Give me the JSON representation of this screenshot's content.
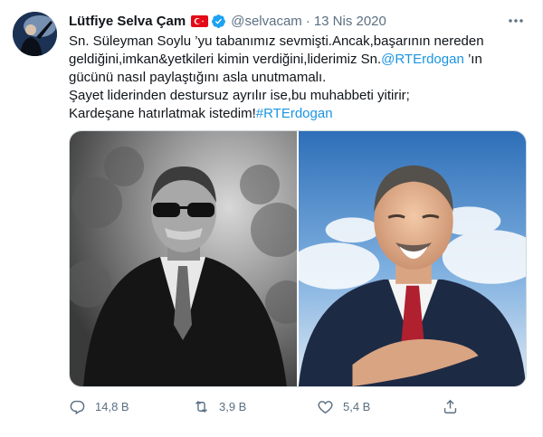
{
  "author": {
    "name": "Lütfiye Selva Çam",
    "handle": "@selvacam",
    "separator": "·",
    "date": "13 Nis 2020"
  },
  "tweet": {
    "line1": "Sn. Süleyman Soylu ’yu tabanımız sevmişti.Ancak,başarının nereden",
    "line2_pre": "geldiğini,imkan&yetkileri kimin verdiğini,liderimiz Sn.",
    "line2_mention": "@RTErdogan",
    "line2_post": " ’ın",
    "line3": "gücünü nasıl paylaştığını asla unutmamalı.",
    "line4": "Şayet liderinden destursuz ayrılır ise,bu muhabbeti yitirir;",
    "line5_pre": "Kardeşane hatırlatmak istedim!",
    "line5_hashtag": "#RTErdogan"
  },
  "actions": {
    "reply_count": "14,8 B",
    "retweet_count": "3,9 B",
    "like_count": "5,4 B"
  },
  "colors": {
    "link": "#1b95e0",
    "verified": "#1da1f2",
    "secondary_text": "#5b7083"
  },
  "icons": [
    "verified-badge-icon",
    "turkish-flag-icon",
    "more-options-icon",
    "reply-icon",
    "retweet-icon",
    "like-icon",
    "share-icon"
  ]
}
